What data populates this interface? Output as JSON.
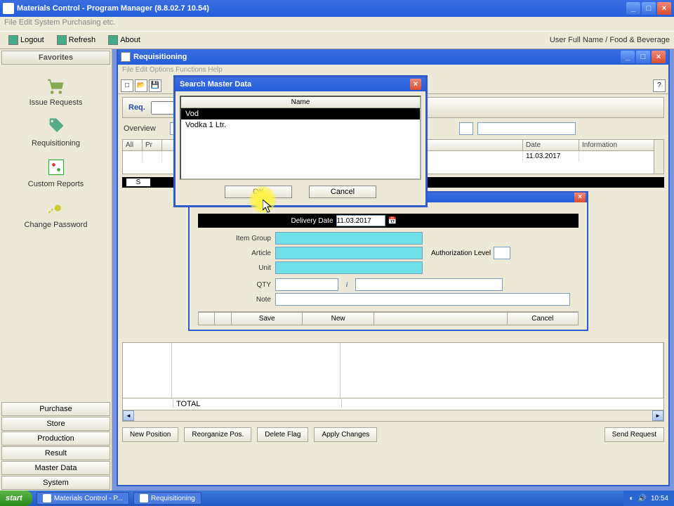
{
  "app": {
    "title": "Materials Control - Program Manager (8.8.02.7 10.54)",
    "user_label": "User Full Name / Food & Beverage"
  },
  "win_controls": {
    "min": "_",
    "max": "□",
    "close": "×"
  },
  "menubar": "File  Edit  System  Purchasing  etc.",
  "toolbar": {
    "logout": "Logout",
    "refresh": "Refresh",
    "about": "About"
  },
  "sidebar": {
    "header": "Favorites",
    "items": [
      {
        "label": "Issue Requests"
      },
      {
        "label": "Requisitioning"
      },
      {
        "label": "Custom Reports"
      },
      {
        "label": "Change Password"
      }
    ],
    "bottom": [
      "Purchase",
      "Store",
      "Production",
      "Result",
      "Master Data",
      "System"
    ]
  },
  "mdi": {
    "title": "Requisitioning",
    "menu": "File  Edit  Options  Functions  Help",
    "header_label": "Req.",
    "overview_label": "Overview",
    "grid": {
      "headers": [
        "All",
        "Pr",
        "Date",
        "Information"
      ],
      "row0_date": "11.03.2017"
    },
    "blackbar_prefix": "S",
    "total_label": "TOTAL"
  },
  "detail": {
    "delivery_date_label": "Delivery Date",
    "delivery_date": "11.03.2017",
    "group_label": "Item Group",
    "article_label": "Article",
    "auth_label": "Authorization Level",
    "unit_label": "Unit",
    "qty_label": "QTY",
    "info_mark": "i",
    "note_label": "Note",
    "buttons": {
      "save": "Save",
      "new": "New",
      "cancel": "Cancel"
    }
  },
  "bottom_buttons": {
    "new_position": "New Position",
    "reorganize": "Reorganize Pos.",
    "delete_flag": "Delete Flag",
    "apply_changes": "Apply Changes",
    "send_request": "Send Request"
  },
  "search": {
    "title": "Search Master Data",
    "name_header": "Name",
    "filter_text": "Vod",
    "item0": "Vodka 1 Ltr.",
    "ok": "OK",
    "cancel": "Cancel"
  },
  "taskbar": {
    "start": "start",
    "task0": "Materials Control - P...",
    "task1": "Requisitioning",
    "clock": "10:54"
  }
}
